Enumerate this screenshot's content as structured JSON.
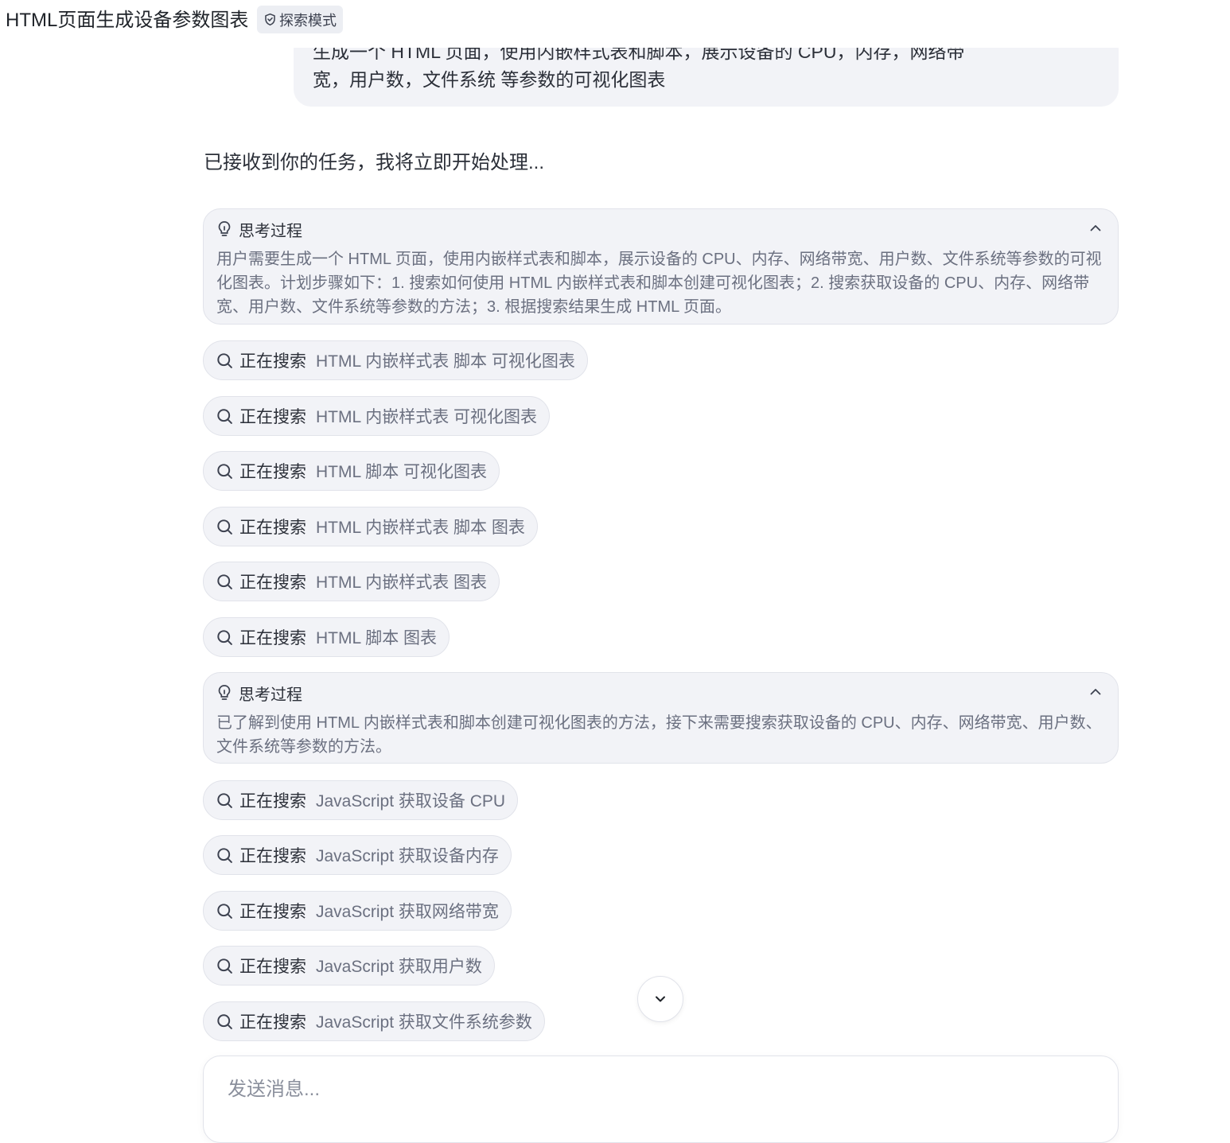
{
  "header": {
    "title": "HTML页面生成设备参数图表",
    "mode_badge": "探索模式"
  },
  "user_message": {
    "clipped_line": "生成一个 HTML 页面，使用内嵌样式表和脚本，展示设备的 CPU，内存，网络带",
    "last_line": "宽，用户数，文件系统 等参数的可视化图表"
  },
  "assistant": {
    "ack": "已接收到你的任务，我将立即开始处理..."
  },
  "thinking": [
    {
      "title": "思考过程",
      "body": "用户需要生成一个 HTML 页面，使用内嵌样式表和脚本，展示设备的 CPU、内存、网络带宽、用户数、文件系统等参数的可视化图表。计划步骤如下：1. 搜索如何使用 HTML 内嵌样式表和脚本创建可视化图表；2. 搜索获取设备的 CPU、内存、网络带宽、用户数、文件系统等参数的方法；3. 根据搜索结果生成 HTML 页面。"
    },
    {
      "title": "思考过程",
      "body": "已了解到使用 HTML 内嵌样式表和脚本创建可视化图表的方法，接下来需要搜索获取设备的 CPU、内存、网络带宽、用户数、文件系统等参数的方法。"
    }
  ],
  "search_label": "正在搜索",
  "searches_group1": [
    "HTML 内嵌样式表 脚本 可视化图表",
    "HTML 内嵌样式表 可视化图表",
    "HTML 脚本 可视化图表",
    "HTML 内嵌样式表 脚本 图表",
    "HTML 内嵌样式表 图表",
    "HTML 脚本 图表"
  ],
  "searches_group2": [
    "JavaScript 获取设备 CPU",
    "JavaScript 获取设备内存",
    "JavaScript 获取网络带宽",
    "JavaScript 获取用户数",
    "JavaScript 获取文件系统参数"
  ],
  "composer": {
    "placeholder": "发送消息..."
  }
}
